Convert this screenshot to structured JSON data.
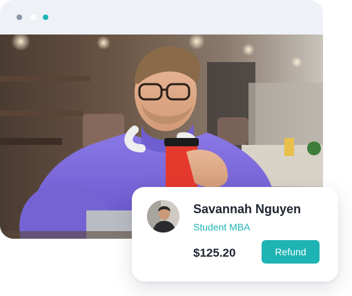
{
  "window": {
    "controls": [
      {
        "name": "dot-1",
        "color": "#8a93a8"
      },
      {
        "name": "dot-2",
        "color": "#ffffff"
      },
      {
        "name": "dot-3",
        "color": "#1fb4b4"
      }
    ],
    "photo_icon": "person-with-cup-photo"
  },
  "card": {
    "avatar_icon": "user-avatar-photo",
    "name": "Savannah Nguyen",
    "role": "Student MBA",
    "amount": "$125.20",
    "refund_label": "Refund"
  },
  "colors": {
    "accent": "#1fb4b4",
    "text_dark": "#1e2430",
    "window_bg": "#eef2f6"
  }
}
